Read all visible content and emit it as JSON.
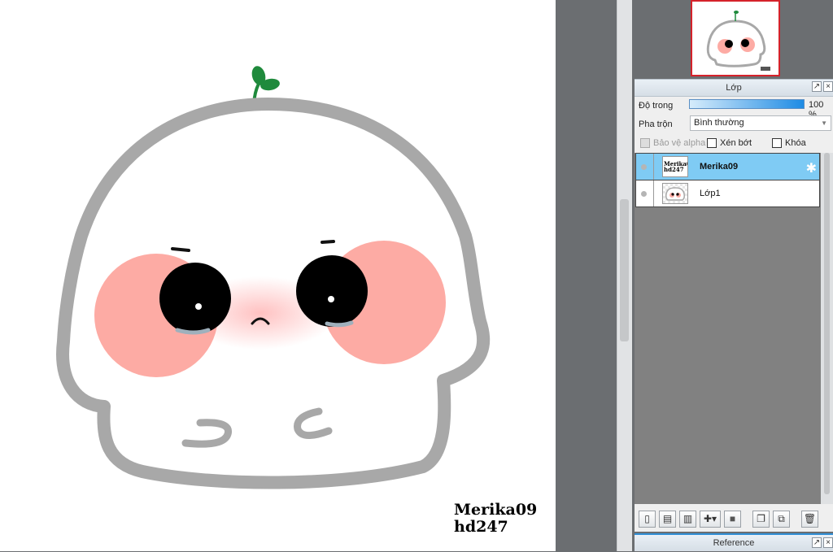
{
  "canvas": {
    "signature_line1": "Merika09",
    "signature_line2": "hd247"
  },
  "layer_panel": {
    "title": "Lớp",
    "opacity_label": "Độ trong",
    "opacity_value": "100 %",
    "opacity_fraction": 1.0,
    "blend_label": "Pha trộn",
    "blend_value": "Bình thường",
    "checkboxes": {
      "protect_alpha": "Bảo vệ alpha",
      "clipping": "Xén bớt",
      "lock": "Khóa"
    },
    "layers": [
      {
        "name": "Merika09",
        "thumb_text1": "Merika09",
        "thumb_text2": "hd247",
        "selected": true
      },
      {
        "name": "Lớp1",
        "selected": false
      }
    ]
  },
  "reference_panel": {
    "title": "Reference"
  },
  "icons": {
    "close": "×",
    "detach": "↗",
    "gear": "✱",
    "dropdown": "▼"
  },
  "colors": {
    "selected_layer": "#7fcbf4",
    "opacity_bar": "#1e8be4",
    "nav_border": "#d5222a"
  }
}
